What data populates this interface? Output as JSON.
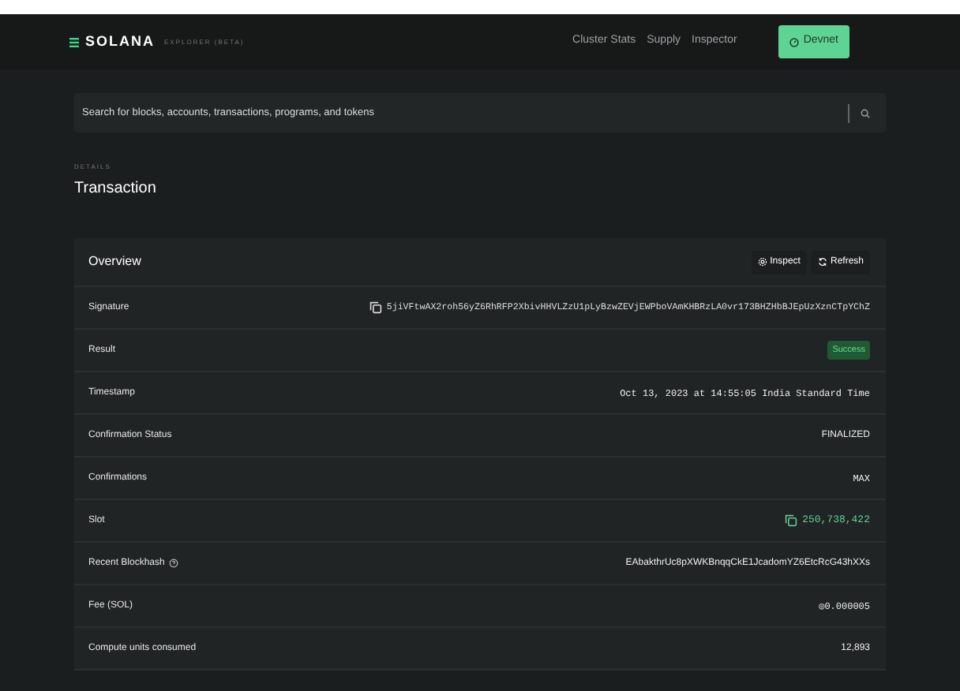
{
  "header": {
    "logo": "SOLANA",
    "logo_sub": "EXPLORER (BETA)",
    "nav": [
      "Cluster Stats",
      "Supply",
      "Inspector"
    ],
    "cluster_button": "Devnet"
  },
  "search": {
    "placeholder": "Search for blocks, accounts, transactions, programs, and tokens"
  },
  "page": {
    "eyebrow": "DETAILS",
    "title": "Transaction"
  },
  "overview": {
    "title": "Overview",
    "actions": [
      {
        "label": "Inspect",
        "kind": "inspect"
      },
      {
        "label": "Refresh",
        "kind": "refresh"
      }
    ],
    "rows": [
      {
        "label": "Signature",
        "value": "5jiVFtwAX2roh56yZ6RhRFP2XbivHHVLZzU1pLyBzwZEVjEWPboVAmKHBRzLA0vr173BHZHbBJEpUzXznCTpYChZ",
        "kind": "copy-mono"
      },
      {
        "label": "Result",
        "value": "Success",
        "kind": "badge"
      },
      {
        "label": "Timestamp",
        "value": "Oct 13, 2023 at 14:55:05 India Standard Time",
        "kind": "mono"
      },
      {
        "label": "Confirmation Status",
        "value": "FINALIZED",
        "kind": "text"
      },
      {
        "label": "Confirmations",
        "value": "MAX",
        "kind": "mono"
      },
      {
        "label": "Slot",
        "value": "250,738,422",
        "kind": "copy-link"
      },
      {
        "label": "Recent Blockhash",
        "value": "EAbakthrUc8pXWKBnqqCkE1JcadomYZ6EtcRcG43hXXs",
        "kind": "text",
        "help": true
      },
      {
        "label": "Fee (SOL)",
        "value": "◎0.000005",
        "kind": "mono"
      },
      {
        "label": "Compute units consumed",
        "value": "12,893",
        "kind": "text"
      }
    ]
  }
}
